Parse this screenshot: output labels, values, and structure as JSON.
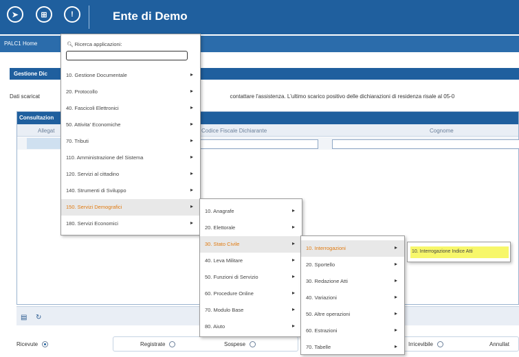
{
  "header": {
    "title": "Ente di Demo",
    "icons": [
      "compass-icon",
      "apps-grid-icon",
      "info-icon"
    ],
    "icon_glyphs": [
      "➤",
      "⊞",
      "!"
    ],
    "color": "#1f5f9e"
  },
  "nav": {
    "home_label": "PALC1 Home"
  },
  "panel": {
    "title": "Gestione Dic",
    "info_left": "Dati scaricat",
    "info_right": "contattare l'assistenza. L'ultimo scarico positivo delle dichiarazioni di residenza risale al 05-0"
  },
  "grid": {
    "title": "Consultazion",
    "columns": [
      "Allegat",
      "Codice Fiscale Dichiarante",
      "Cognome"
    ]
  },
  "status": {
    "items": [
      {
        "label": "Ricevute",
        "selected": true
      },
      {
        "label": "Registrate",
        "selected": false
      },
      {
        "label": "Sospese",
        "selected": false
      },
      {
        "label": "Irricevibile",
        "selected": false
      },
      {
        "label": "Annullat",
        "selected": false
      }
    ]
  },
  "menu_main": {
    "search_label": "Ricerca applicazioni:",
    "search_value": "",
    "items": [
      {
        "label": "10. Gestione Documentale"
      },
      {
        "label": "20. Protocollo"
      },
      {
        "label": "40. Fascicoli Elettronici"
      },
      {
        "label": "50. Attivita' Economiche"
      },
      {
        "label": "70. Tributi"
      },
      {
        "label": "110. Amministrazione del Sistema"
      },
      {
        "label": "120. Servizi al cittadino"
      },
      {
        "label": "140. Strumenti di Sviluppo"
      },
      {
        "label": "150. Servizi Demografici",
        "active": true
      },
      {
        "label": "180. Servizi Economici"
      }
    ]
  },
  "menu_demografici": {
    "items": [
      {
        "label": "10. Anagrafe"
      },
      {
        "label": "20. Elettorale"
      },
      {
        "label": "30. Stato Civile",
        "active": true
      },
      {
        "label": "40. Leva Militare"
      },
      {
        "label": "50. Funzioni di Servizio"
      },
      {
        "label": "60. Procedure Online"
      },
      {
        "label": "70. Modulo Base"
      },
      {
        "label": "80. Aiuto"
      }
    ]
  },
  "menu_stato_civile": {
    "items": [
      {
        "label": "10. Interrogazioni",
        "active": true
      },
      {
        "label": "20. Sportello"
      },
      {
        "label": "30. Redazione Atti"
      },
      {
        "label": "40. Variazioni"
      },
      {
        "label": "50. Altre operazioni"
      },
      {
        "label": "60. Estrazioni"
      },
      {
        "label": "70. Tabelle"
      }
    ]
  },
  "menu_interrogazioni": {
    "item": "10. Interrogazione Indice Atti",
    "highlight_color": "#f7f76a"
  },
  "arrow_glyph": "▸"
}
